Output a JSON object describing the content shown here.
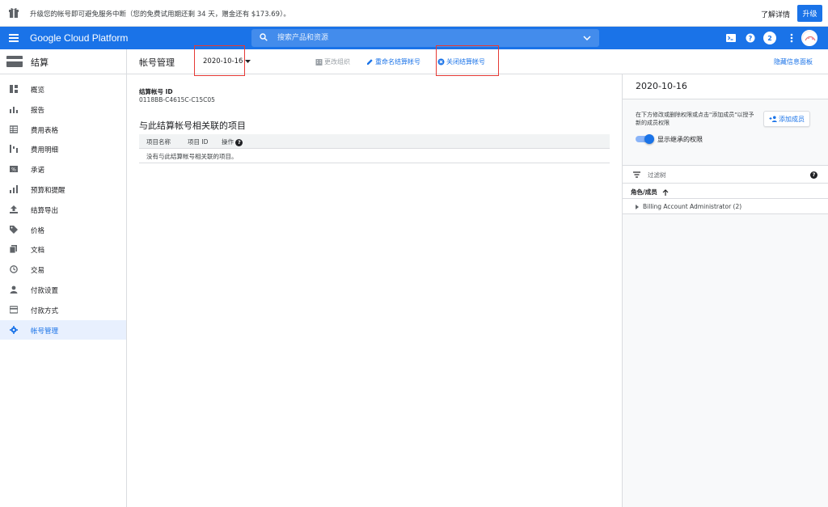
{
  "promo": {
    "text": "升级您的帐号即可避免服务中断（您的免费试用期还剩 34 天，赠金还有 $173.69）。",
    "learn_more": "了解详情",
    "upgrade": "升级"
  },
  "topbar": {
    "brand": "Google Cloud Platform",
    "search_placeholder": "搜索产品和资源",
    "notification_count": "2"
  },
  "sidebar": {
    "title": "结算",
    "items": [
      {
        "label": "概览",
        "icon": "dashboard-icon"
      },
      {
        "label": "报告",
        "icon": "bar-chart-icon"
      },
      {
        "label": "费用表格",
        "icon": "table-icon"
      },
      {
        "label": "费用明细",
        "icon": "breakdown-icon"
      },
      {
        "label": "承诺",
        "icon": "percent-icon"
      },
      {
        "label": "预算和提醒",
        "icon": "budget-icon"
      },
      {
        "label": "结算导出",
        "icon": "upload-icon"
      },
      {
        "label": "价格",
        "icon": "tag-icon"
      },
      {
        "label": "文档",
        "icon": "document-icon"
      },
      {
        "label": "交易",
        "icon": "clock-icon"
      },
      {
        "label": "付款设置",
        "icon": "person-icon"
      },
      {
        "label": "付款方式",
        "icon": "credit-card-icon"
      },
      {
        "label": "帐号管理",
        "icon": "gear-icon",
        "active": true
      }
    ]
  },
  "subheader": {
    "title": "帐号管理",
    "account_selector": "2020-10-16",
    "change_org": "更改组织",
    "rename": "重命名结算帐号",
    "close": "关闭结算帐号",
    "hide_panel": "隐藏信息面板"
  },
  "main": {
    "account_id_label": "结算帐号 ID",
    "account_id_value": "0118BB-C4615C-C15C05",
    "projects_title": "与此结算帐号相关联的项目",
    "table_headers": [
      "项目名称",
      "项目 ID",
      "操作"
    ],
    "empty_message": "没有与此结算帐号相关联的项目。"
  },
  "info_panel": {
    "title": "2020-10-16",
    "description": "在下方修改或删除权限或点击\"添加成员\"以授予新的成员权限",
    "add_member": "添加成员",
    "show_inherited": "显示继承的权限",
    "filter_placeholder": "过滤树",
    "role_header": "角色/成员",
    "roles": [
      {
        "label": "Billing Account Administrator (2)"
      }
    ]
  },
  "colors": {
    "brand_blue": "#1a73e8",
    "highlight_red": "#e53935"
  }
}
